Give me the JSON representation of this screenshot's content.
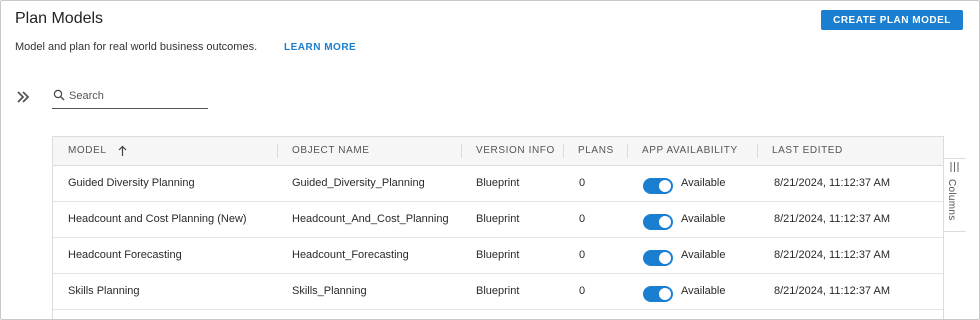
{
  "header": {
    "title": "Plan Models",
    "create_button": "CREATE PLAN MODEL",
    "subtitle": "Model and plan for real world business outcomes.",
    "learn_more": "LEARN MORE"
  },
  "search": {
    "placeholder": "Search",
    "value": ""
  },
  "table": {
    "columns": [
      {
        "key": "model",
        "label": "MODEL",
        "sort": "ascending"
      },
      {
        "key": "object_name",
        "label": "OBJECT NAME"
      },
      {
        "key": "version_info",
        "label": "VERSION INFO"
      },
      {
        "key": "plans",
        "label": "PLANS"
      },
      {
        "key": "app_availability",
        "label": "APP AVAILABILITY"
      },
      {
        "key": "last_edited",
        "label": "LAST EDITED"
      }
    ],
    "rows": [
      {
        "model": "Guided Diversity Planning",
        "object_name": "Guided_Diversity_Planning",
        "version_info": "Blueprint",
        "plans": "0",
        "available": true,
        "availability_label": "Available",
        "last_edited": "8/21/2024, 11:12:37 AM"
      },
      {
        "model": "Headcount and Cost Planning (New)",
        "object_name": "Headcount_And_Cost_Planning",
        "version_info": "Blueprint",
        "plans": "0",
        "available": true,
        "availability_label": "Available",
        "last_edited": "8/21/2024, 11:12:37 AM"
      },
      {
        "model": "Headcount Forecasting",
        "object_name": "Headcount_Forecasting",
        "version_info": "Blueprint",
        "plans": "0",
        "available": true,
        "availability_label": "Available",
        "last_edited": "8/21/2024, 11:12:37 AM"
      },
      {
        "model": "Skills Planning",
        "object_name": "Skills_Planning",
        "version_info": "Blueprint",
        "plans": "0",
        "available": true,
        "availability_label": "Available",
        "last_edited": "8/21/2024, 11:12:37 AM"
      }
    ]
  },
  "side_panel": {
    "columns_label": "Columns"
  },
  "icons": {
    "expand": "double-chevron-right-icon",
    "search": "search-icon",
    "sort": "arrow-up-icon",
    "columns": "columns-icon"
  },
  "colors": {
    "accent": "#1a7fd0",
    "header_bg": "#f6f6f7",
    "border": "#dcdcdc"
  }
}
